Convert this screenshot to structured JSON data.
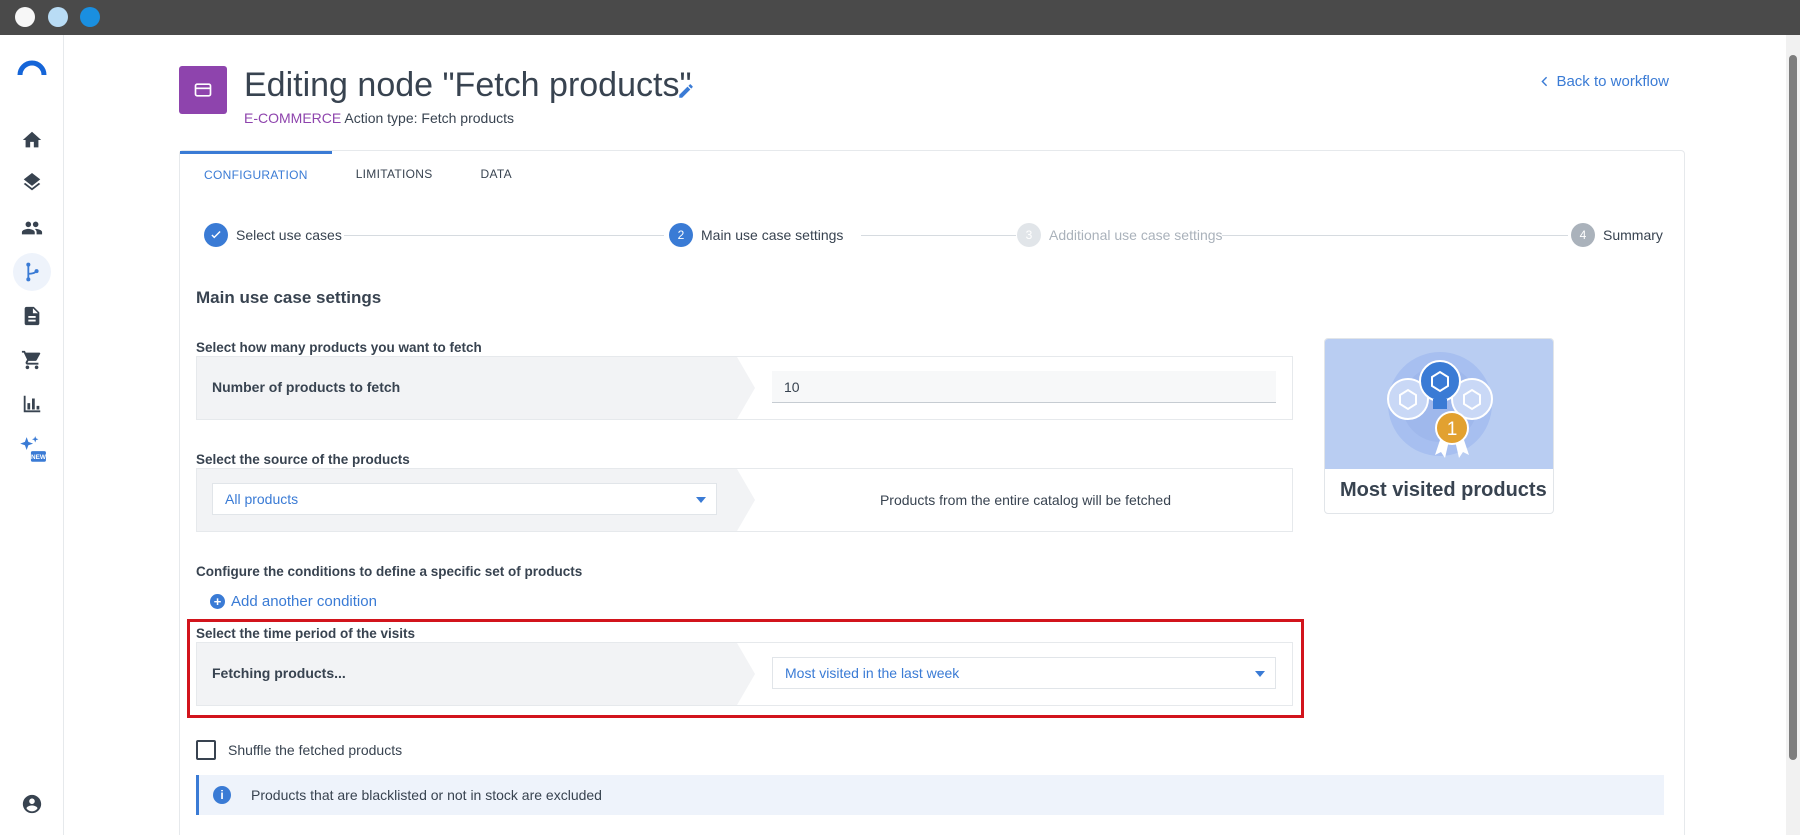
{
  "header": {
    "title": "Editing node \"Fetch products\"",
    "category": "E-COMMERCE",
    "action_type": "Action type: Fetch products",
    "back_link": "Back to workflow"
  },
  "tabs": [
    {
      "label": "CONFIGURATION",
      "active": true
    },
    {
      "label": "LIMITATIONS",
      "active": false
    },
    {
      "label": "DATA",
      "active": false
    }
  ],
  "stepper": [
    {
      "number": "",
      "label": "Select use cases",
      "state": "done"
    },
    {
      "number": "2",
      "label": "Main use case settings",
      "state": "active"
    },
    {
      "number": "3",
      "label": "Additional use case settings",
      "state": "inactive"
    },
    {
      "number": "4",
      "label": "Summary",
      "state": "todo"
    }
  ],
  "section_title": "Main use case settings",
  "quantity": {
    "label": "Select how many products you want to fetch",
    "row_label": "Number of products to fetch",
    "value": "10"
  },
  "source": {
    "label": "Select the source of the products",
    "selected": "All products",
    "description": "Products from the entire catalog will be fetched"
  },
  "conditions": {
    "label": "Configure the conditions to define a specific set of products",
    "add_label": "Add another condition"
  },
  "time_period": {
    "label": "Select the time period of the visits",
    "row_label": "Fetching products...",
    "selected": "Most visited in the last week"
  },
  "shuffle": {
    "label": "Shuffle the fetched products",
    "checked": false
  },
  "info": {
    "text": "Products that are blacklisted or not in stock are excluded"
  },
  "use_case_tile": {
    "label": "Most visited products",
    "badge": "1"
  },
  "sidebar": {
    "items": [
      {
        "name": "home-icon"
      },
      {
        "name": "layers-icon"
      },
      {
        "name": "people-icon"
      },
      {
        "name": "workflow-icon",
        "active": true
      },
      {
        "name": "document-icon"
      },
      {
        "name": "cart-icon"
      },
      {
        "name": "chart-icon"
      },
      {
        "name": "ai-sparkle-icon",
        "badge": "NEW"
      },
      {
        "name": "account-icon"
      }
    ]
  },
  "colors": {
    "accent": "#3a7bd5",
    "category": "#8e44ad",
    "highlight": "#d2141c",
    "text": "#384350"
  }
}
